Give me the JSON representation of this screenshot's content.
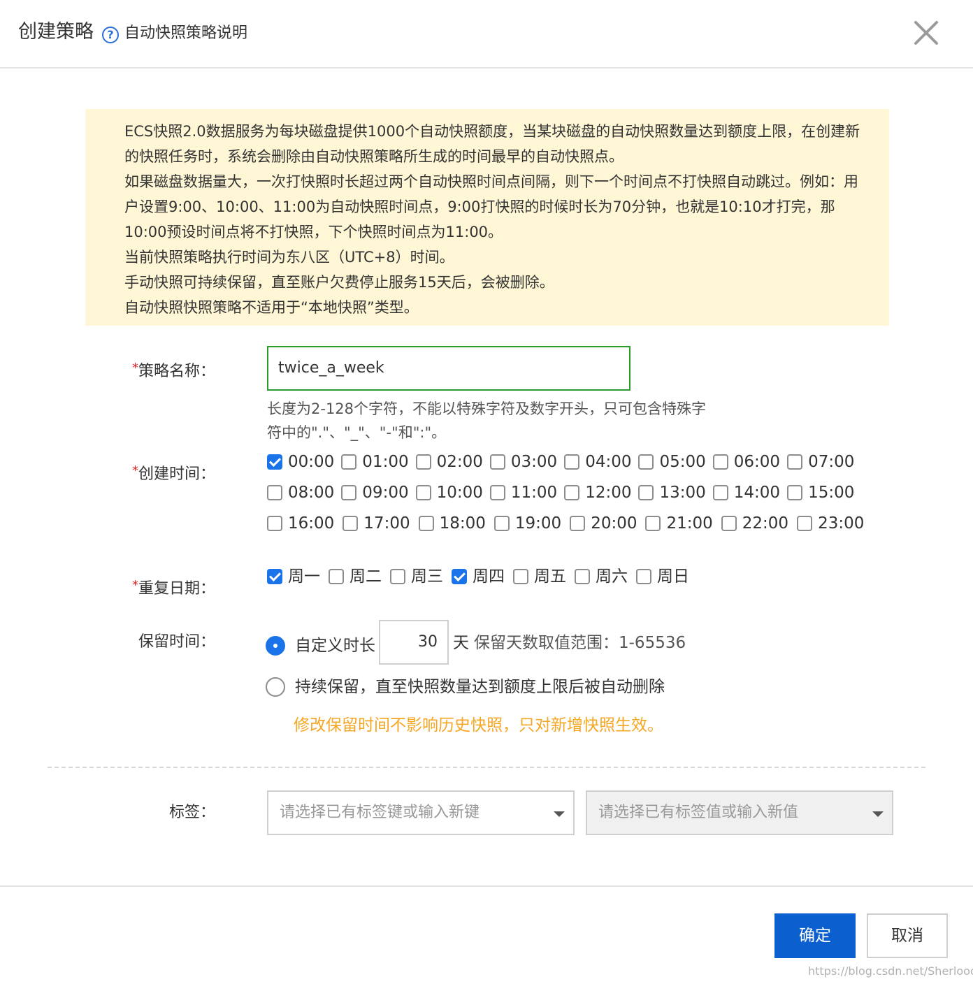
{
  "header": {
    "title": "创建策略",
    "help_icon_label": "?",
    "help_link": "自动快照策略说明"
  },
  "notice": {
    "lines": [
      "ECS快照2.0数据服务为每块磁盘提供1000个自动快照额度，当某块磁盘的自动快照数量达到额度上限，在创建新的快照任务时，系统会删除由自动快照策略所生成的时间最早的自动快照点。",
      "如果磁盘数据量大，一次打快照时长超过两个自动快照时间点间隔，则下一个时间点不打快照自动跳过。例如：用户设置9:00、10:00、11:00为自动快照时间点，9:00打快照的时候时长为70分钟，也就是10:10才打完，那10:00预设时间点将不打快照，下个快照时间点为11:00。",
      "当前快照策略执行时间为东八区（UTC+8）时间。",
      "手动快照可持续保留，直至账户欠费停止服务15天后，会被删除。",
      "自动快照快照策略不适用于“本地快照”类型。"
    ]
  },
  "form": {
    "required_mark": "*",
    "name_label": "策略名称：",
    "name_value": "twice_a_week",
    "name_hint": "长度为2-128个字符，不能以特殊字符及数字开头，只可包含特殊字符中的\".\"、\"_\"、\"-\"和\":\"。",
    "time_label": "创建时间：",
    "times": [
      {
        "label": "00:00",
        "checked": true
      },
      {
        "label": "01:00",
        "checked": false
      },
      {
        "label": "02:00",
        "checked": false
      },
      {
        "label": "03:00",
        "checked": false
      },
      {
        "label": "04:00",
        "checked": false
      },
      {
        "label": "05:00",
        "checked": false
      },
      {
        "label": "06:00",
        "checked": false
      },
      {
        "label": "07:00",
        "checked": false
      },
      {
        "label": "08:00",
        "checked": false
      },
      {
        "label": "09:00",
        "checked": false
      },
      {
        "label": "10:00",
        "checked": false
      },
      {
        "label": "11:00",
        "checked": false
      },
      {
        "label": "12:00",
        "checked": false
      },
      {
        "label": "13:00",
        "checked": false
      },
      {
        "label": "14:00",
        "checked": false
      },
      {
        "label": "15:00",
        "checked": false
      },
      {
        "label": "16:00",
        "checked": false
      },
      {
        "label": "17:00",
        "checked": false
      },
      {
        "label": "18:00",
        "checked": false
      },
      {
        "label": "19:00",
        "checked": false
      },
      {
        "label": "20:00",
        "checked": false
      },
      {
        "label": "21:00",
        "checked": false
      },
      {
        "label": "22:00",
        "checked": false
      },
      {
        "label": "23:00",
        "checked": false
      }
    ],
    "repeat_label": "重复日期：",
    "days": [
      {
        "label": "周一",
        "checked": true
      },
      {
        "label": "周二",
        "checked": false
      },
      {
        "label": "周三",
        "checked": false
      },
      {
        "label": "周四",
        "checked": true
      },
      {
        "label": "周五",
        "checked": false
      },
      {
        "label": "周六",
        "checked": false
      },
      {
        "label": "周日",
        "checked": false
      }
    ],
    "retention_label": "保留时间：",
    "retention_custom_label": "自定义时长",
    "retention_days_value": "30",
    "retention_unit": "天",
    "retention_range": "保留天数取值范围：1-65536",
    "retention_forever_label": "持续保留，直至快照数量达到额度上限后被自动删除",
    "retention_selected": "custom",
    "retention_warning": "修改保留时间不影响历史快照，只对新增快照生效。",
    "tags_label": "标签：",
    "tag_key_placeholder": "请选择已有标签键或输入新键",
    "tag_value_placeholder": "请选择已有标签值或输入新值"
  },
  "footer": {
    "confirm_label": "确定",
    "cancel_label": "取消"
  },
  "watermark": "https://blog.csdn.net/Sherloocck",
  "colors": {
    "primary": "#0b5fce",
    "checkbox_checked": "#1a73e8",
    "notice_background": "#fff6d5",
    "warning_text": "#f5a623",
    "required_mark": "#e0242a",
    "input_focus_border": "#2e9a2e"
  }
}
